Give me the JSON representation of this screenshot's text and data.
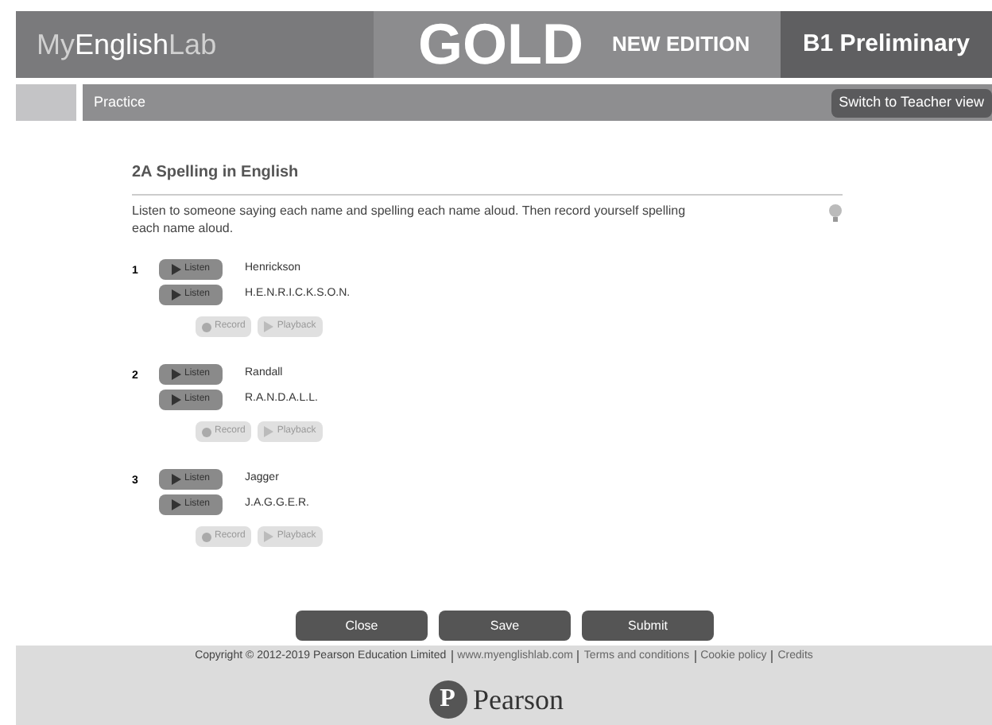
{
  "header": {
    "logo_parts": [
      "My",
      "English",
      "Lab"
    ],
    "product": "GOLD",
    "edition": "NEW EDITION",
    "level": "B1 Preliminary"
  },
  "nav": {
    "title": "Practice",
    "switch_button": "Switch to Teacher view"
  },
  "exercise": {
    "title": "2A Spelling in English",
    "instruction": "Listen to someone saying each name and spelling each name aloud. Then record yourself spelling each name aloud.",
    "items": [
      {
        "number": "1",
        "lines": [
          {
            "button": "Listen",
            "text": "Henrickson"
          },
          {
            "button": "Listen",
            "text": "H.E.N.R.I.C.K.S.O.N."
          }
        ],
        "record": "Record",
        "playback": "Playback"
      },
      {
        "number": "2",
        "lines": [
          {
            "button": "Listen",
            "text": "Randall"
          },
          {
            "button": "Listen",
            "text": "R.A.N.D.A.L.L."
          }
        ],
        "record": "Record",
        "playback": "Playback"
      },
      {
        "number": "3",
        "lines": [
          {
            "button": "Listen",
            "text": "Jagger"
          },
          {
            "button": "Listen",
            "text": "J.A.G.G.E.R."
          }
        ],
        "record": "Record",
        "playback": "Playback"
      }
    ]
  },
  "actions": [
    "Close",
    "Save",
    "Submit"
  ],
  "footer": {
    "copyright": "Copyright © 2012-2019 Pearson Education Limited",
    "links": [
      "www.myenglishlab.com",
      "Terms and conditions",
      "Cookie policy",
      "Credits"
    ],
    "logo_mark": "P",
    "logo_text": "Pearson"
  }
}
